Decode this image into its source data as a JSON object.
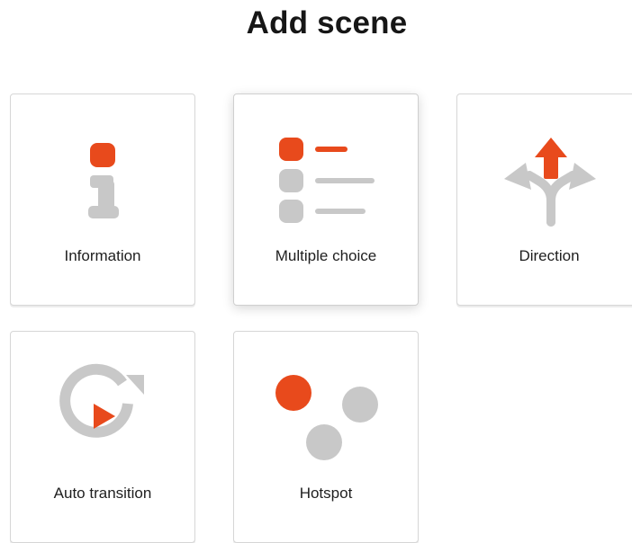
{
  "header": {
    "title": "Add scene"
  },
  "colors": {
    "accent": "#e84a1c",
    "icon_gray": "#c8c8c8",
    "card_border": "#d6d6d6"
  },
  "scene_types": [
    {
      "label": "Information",
      "icon": "information-icon"
    },
    {
      "label": "Multiple choice",
      "icon": "list-icon",
      "hovered": true
    },
    {
      "label": "Direction",
      "icon": "direction-arrows-icon"
    },
    {
      "label": "Auto transition",
      "icon": "auto-transition-icon"
    },
    {
      "label": "Hotspot",
      "icon": "hotspot-icon"
    }
  ]
}
